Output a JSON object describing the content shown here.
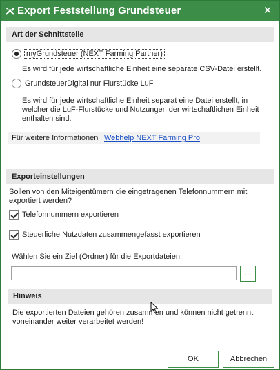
{
  "window": {
    "title": "Export Feststellung Grundsteuer",
    "close_glyph": "✕"
  },
  "interface_section": {
    "header": "Art der Schnittstelle",
    "options": [
      {
        "label": "myGrundsteuer (NEXT Farming Partner)",
        "selected": true,
        "description": [
          "Es wird für jede wirtschaftliche Einheit eine separate CSV-Datei erstellt."
        ]
      },
      {
        "label": "GrundsteuerDigital nur Flurstücke LuF",
        "selected": false,
        "description": [
          "Es wird für jede wirtschaftliche Einheit separat eine Datei erstellt, in",
          "welcher die LuF-Flurstücke und Nutzungen der wirtschaftlichen Einheit",
          "enthalten sind."
        ]
      }
    ],
    "info_label": "Für weitere Informationen",
    "info_link": "Webhelp NEXT Farming Pro"
  },
  "export_settings": {
    "header": "Exporteinstellungen",
    "question": [
      "Sollen von den Miteigentümern die eingetragenen Telefonnummern mit",
      "exportiert werden?"
    ],
    "checkboxes": [
      {
        "label": "Telefonnummern exportieren",
        "checked": true
      },
      {
        "label": "Steuerliche Nutzdaten zusammengefasst exportieren",
        "checked": true
      }
    ],
    "target_label": "Wählen Sie ein Ziel (Ordner) für die Exportdateien:",
    "target_value": "",
    "browse_label": "..."
  },
  "hint_section": {
    "header": "Hinweis",
    "text": [
      "Die exportierten Dateien gehören zusammen und können nicht getrennt",
      "voneinander weiter verarbeitet werden!"
    ]
  },
  "buttons": {
    "ok": "OK",
    "cancel": "Abbrechen"
  },
  "colors": {
    "titlebar": "#3c8d47",
    "section_header": "#e6e6e6",
    "link": "#1a4fc4",
    "button_border": "#3c8d47"
  },
  "icons": {
    "app_icon": "tools-icon",
    "close_icon": "close-icon",
    "cursor": "mouse-pointer-icon"
  }
}
